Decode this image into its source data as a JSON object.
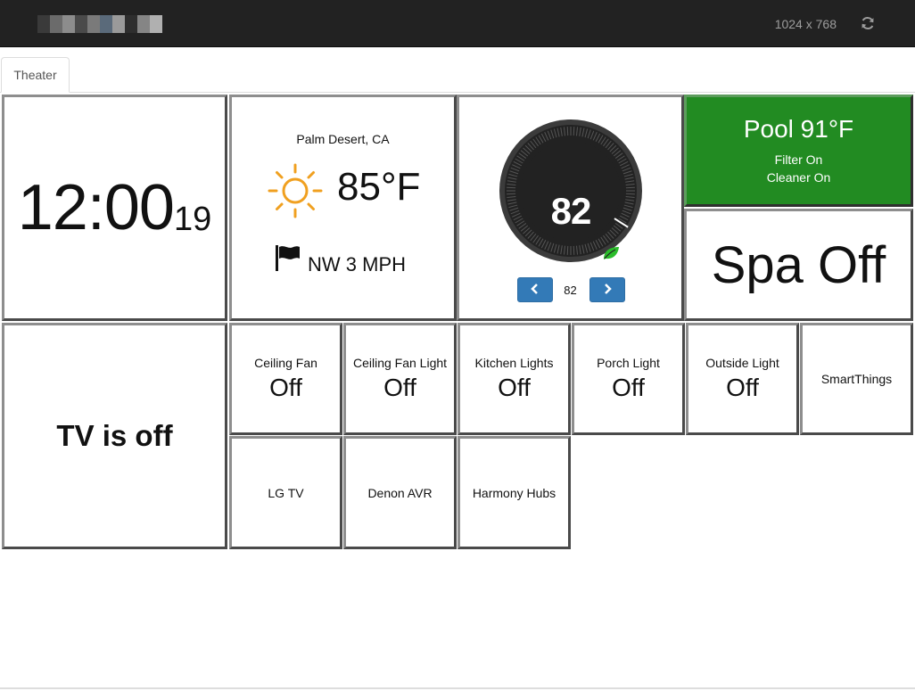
{
  "navbar": {
    "brand_pixels": [
      "#3a3a3a",
      "#6b6b6b",
      "#8c8c8c",
      "#4a4a4a",
      "#7a7a7a",
      "#5a6a7a",
      "#9a9a9a",
      "#2e2e2e",
      "#858585",
      "#b0b0b0"
    ],
    "resolution": "1024 x 768",
    "refresh_icon": "refresh-icon"
  },
  "tabs": [
    {
      "label": "Theater"
    }
  ],
  "clock": {
    "time": "12:00",
    "seconds": "19"
  },
  "weather": {
    "location": "Palm Desert, CA",
    "temperature": "85°F",
    "condition_icon": "sun-icon",
    "wind_icon": "flag-icon",
    "wind": "NW 3 MPH",
    "sun_color": "#f0a020"
  },
  "thermostat": {
    "target": "82",
    "current": "82",
    "setpoint": "82",
    "mode_icon": "leaf-icon",
    "leaf_color": "#2bbd2b",
    "button_color": "#337ab7"
  },
  "pool": {
    "title": "Pool 91°F",
    "filter": "Filter On",
    "cleaner": "Cleaner On",
    "color": "#228b22"
  },
  "spa": {
    "label": "Spa Off"
  },
  "tv": {
    "label": "TV is off"
  },
  "switches": [
    {
      "label": "Ceiling Fan",
      "state": "Off"
    },
    {
      "label": "Ceiling Fan Light",
      "state": "Off"
    },
    {
      "label": "Kitchen Lights",
      "state": "Off"
    },
    {
      "label": "Porch Light",
      "state": "Off"
    },
    {
      "label": "Outside Light",
      "state": "Off"
    }
  ],
  "links": [
    {
      "label": "SmartThings"
    },
    {
      "label": "LG TV"
    },
    {
      "label": "Denon AVR"
    },
    {
      "label": "Harmony Hubs"
    }
  ]
}
